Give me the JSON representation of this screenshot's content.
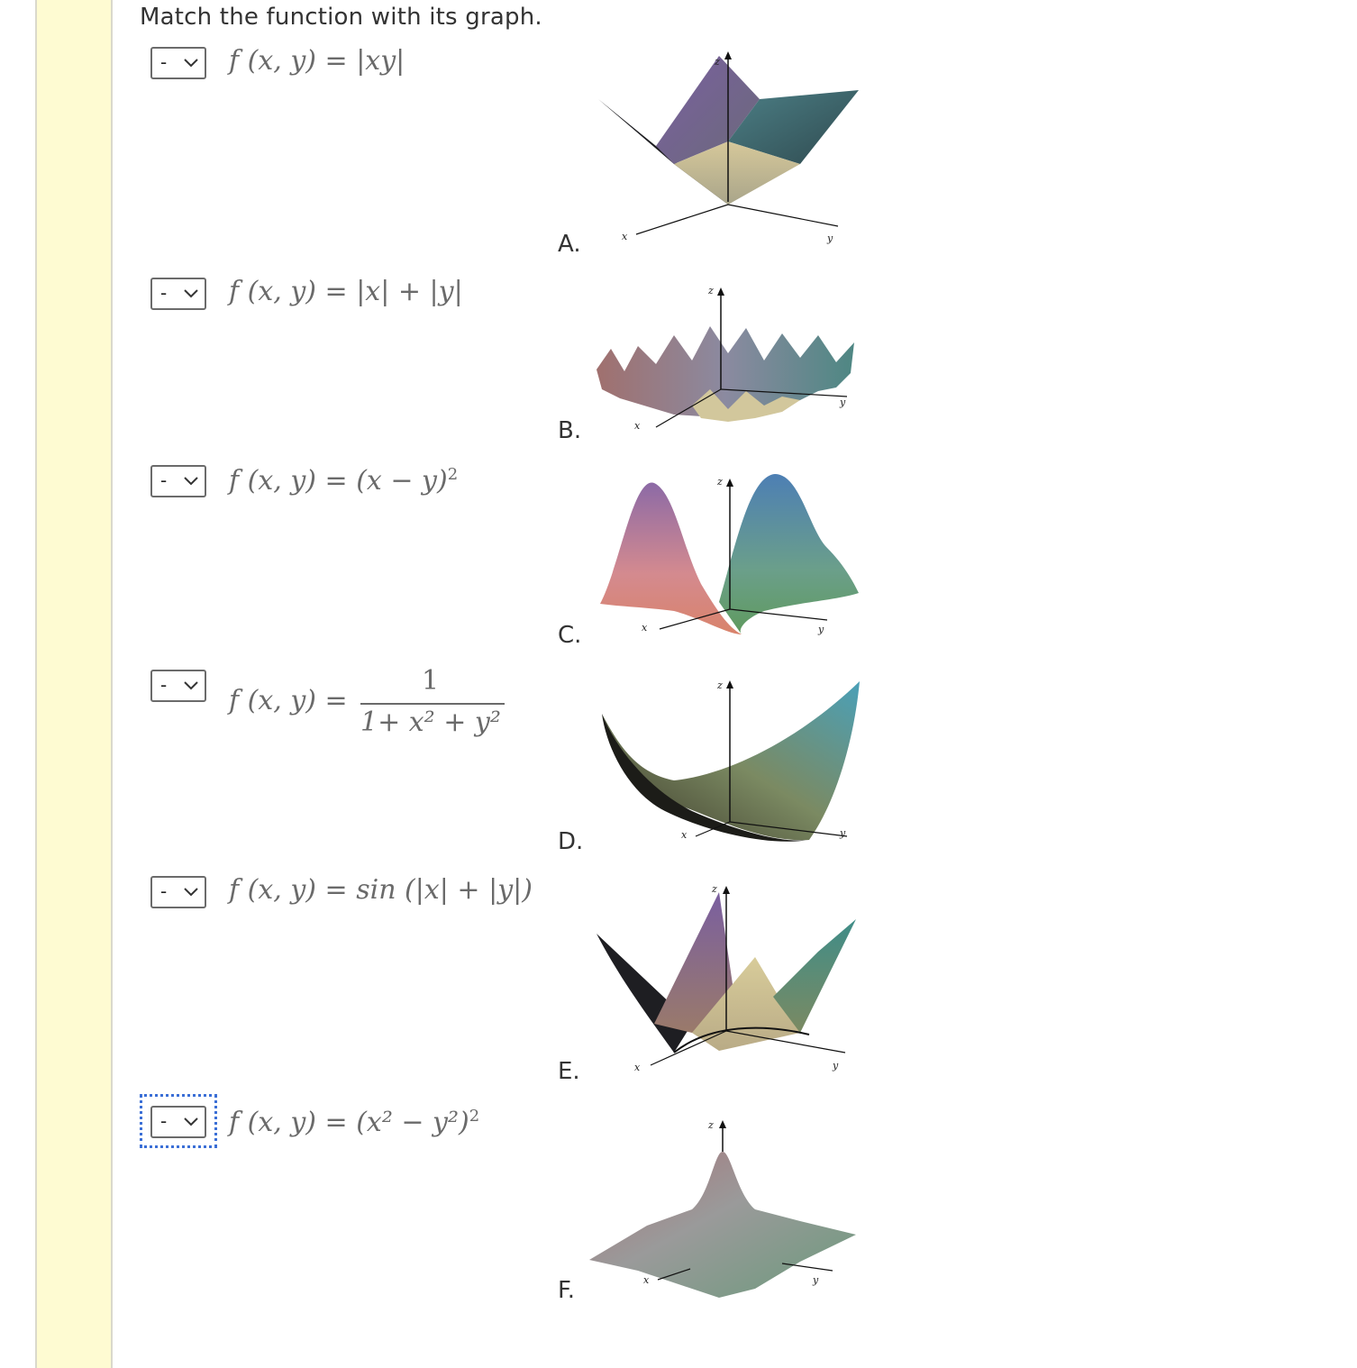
{
  "prompt": "Match the function with its graph.",
  "select_default": "-",
  "functions": [
    {
      "lhs": "f (x, y) = ",
      "rhs": "|xy|"
    },
    {
      "lhs": "f (x, y) = ",
      "rhs": "|x| + |y|"
    },
    {
      "lhs": "f (x, y) = ",
      "rhs": "(x − y)",
      "sup": "2"
    },
    {
      "lhs": "f (x, y) = ",
      "num": "1",
      "den": "1+ x² + y²"
    },
    {
      "lhs": "f (x, y) = ",
      "rhs": "sin (|x|  +  |y|)"
    },
    {
      "lhs": "f (x, y) = ",
      "rhs": "(x² − y²)",
      "sup": "2"
    }
  ],
  "graph_labels": [
    "A.",
    "B.",
    "C.",
    "D.",
    "E.",
    "F."
  ],
  "axis_labels": {
    "x": "x",
    "y": "y",
    "z": "z"
  },
  "colors": {
    "rail": "#fefbd2",
    "focus": "#3b6fd6"
  }
}
